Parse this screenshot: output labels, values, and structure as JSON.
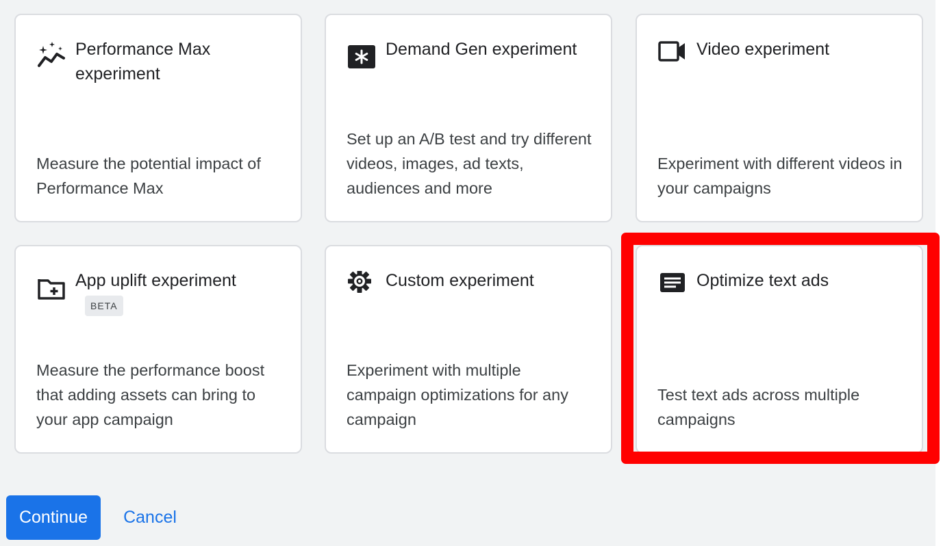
{
  "cards": [
    {
      "title": "Performance Max experiment",
      "description": "Measure the potential impact of Performance Max",
      "icon": "performance-max-icon"
    },
    {
      "title": "Demand Gen experiment",
      "description": "Set up an A/B test and try different videos, images, ad texts, audiences and more",
      "icon": "demand-gen-icon"
    },
    {
      "title": "Video experiment",
      "description": "Experiment with different videos in your campaigns",
      "icon": "video-camera-icon"
    },
    {
      "title": "App uplift experiment",
      "badge": "BETA",
      "description": "Measure the performance boost that adding assets can bring to your app campaign",
      "icon": "folder-add-icon"
    },
    {
      "title": "Custom experiment",
      "description": "Experiment with multiple campaign optimizations for any campaign",
      "icon": "gear-icon"
    },
    {
      "title": "Optimize text ads",
      "description": "Test text ads across multiple campaigns",
      "icon": "text-ad-icon"
    }
  ],
  "actions": {
    "continue_label": "Continue",
    "cancel_label": "Cancel"
  },
  "colors": {
    "accent": "#1a73e8",
    "highlight": "#ff0000",
    "background": "#f1f3f4",
    "card_border": "#dadce0"
  }
}
